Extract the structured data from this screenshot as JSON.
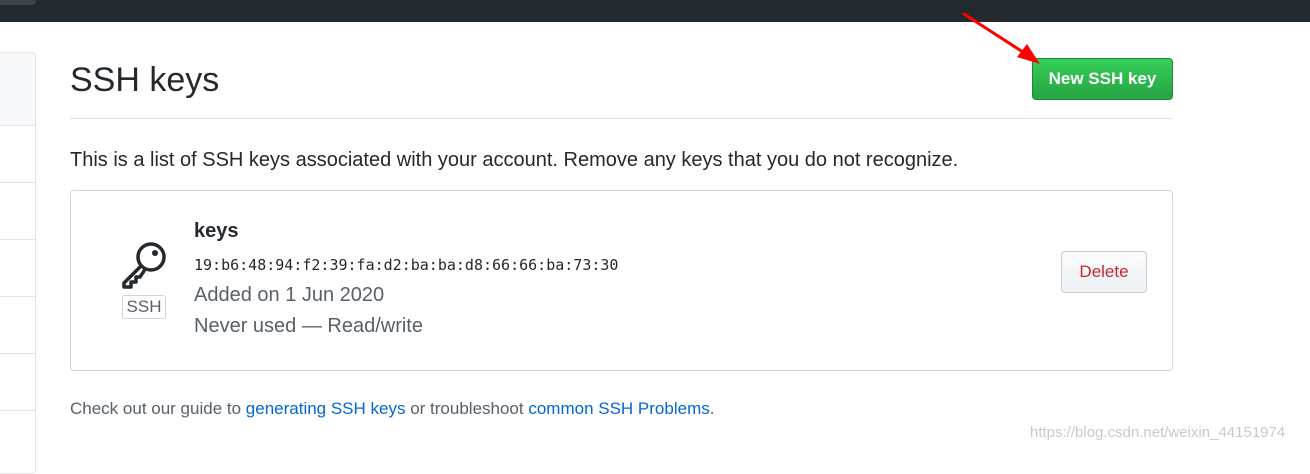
{
  "page": {
    "title": "SSH keys",
    "new_key_button": "New SSH key",
    "intro": "This is a list of SSH keys associated with your account. Remove any keys that you do not recognize."
  },
  "keys": [
    {
      "title": "keys",
      "fingerprint": "19:b6:48:94:f2:39:fa:d2:ba:ba:d8:66:66:ba:73:30",
      "badge": "SSH",
      "added": "Added on 1 Jun 2020",
      "usage": "Never used — Read/write",
      "delete_label": "Delete",
      "icon": "key-icon"
    }
  ],
  "footer": {
    "prefix": "Check out our guide to ",
    "link1": "generating SSH keys",
    "middle": " or troubleshoot ",
    "link2": "common SSH Problems",
    "suffix": "."
  },
  "watermark": "https://blog.csdn.net/weixin_44151974",
  "colors": {
    "primary_button": "#28a745",
    "danger_text": "#cb2431",
    "link": "#0366d6",
    "topbar": "#24292e",
    "annotation_arrow": "#ff0000"
  }
}
